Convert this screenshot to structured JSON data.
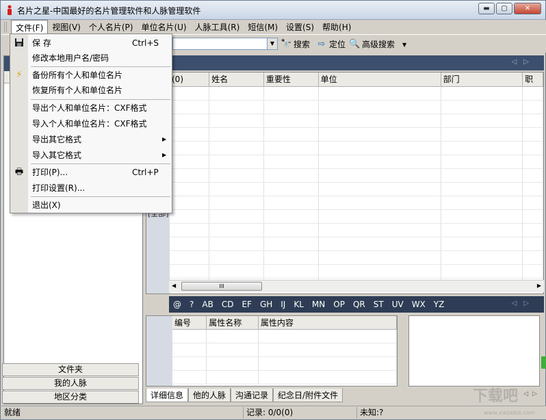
{
  "window": {
    "title": "名片之星-中国最好的名片管理软件和人脉管理软件",
    "minimize": "▬",
    "maximize": "▢",
    "close": "✕"
  },
  "menubar": {
    "items": [
      "文件(F)",
      "视图(V)",
      "个人名片(P)",
      "单位名片(U)",
      "人脉工具(R)",
      "短信(M)",
      "设置(S)",
      "帮助(H)"
    ]
  },
  "toolbar": {
    "search": "搜索",
    "locate": "定位",
    "advanced_search": "高级搜索"
  },
  "file_menu": {
    "save": "保  存",
    "save_shortcut": "Ctrl+S",
    "change_password": "修改本地用户名/密码",
    "backup": "备份所有个人和单位名片",
    "restore": "恢复所有个人和单位名片",
    "export_cxf": "导出个人和单位名片：CXF格式",
    "import_cxf": "导入个人和单位名片：CXF格式",
    "export_other": "导出其它格式",
    "import_other": "导入其它格式",
    "print": "打印(P)...",
    "print_shortcut": "Ctrl+P",
    "print_setup": "打印设置(R)...",
    "exit": "退出(X)"
  },
  "left_panel": {
    "tabs": [
      "文件夹",
      "我的人脉",
      "地区分类"
    ]
  },
  "grid": {
    "columns": [
      "(0)",
      "姓名",
      "重要性",
      "单位",
      "部门",
      "职"
    ],
    "row_marker": "[全部]"
  },
  "alphabet": [
    "@",
    "?",
    "AB",
    "CD",
    "EF",
    "GH",
    "IJ",
    "KL",
    "MN",
    "OP",
    "QR",
    "ST",
    "UV",
    "WX",
    "YZ"
  ],
  "detail": {
    "columns": [
      "编号",
      "属性名称",
      "属性内容"
    ],
    "tabs": [
      "详细信息",
      "他的人脉",
      "沟通记录",
      "纪念日/附件文件"
    ]
  },
  "statusbar": {
    "ready": "就绪",
    "records": "记录: 0/0(0)",
    "unknown": "未知:?"
  },
  "watermark": {
    "text": "下载吧",
    "url": "www.xiazaiba.com"
  },
  "colors": {
    "dark_header": "#3c4f6e",
    "alpha_bar": "#2e3d55",
    "chrome": "#d4d0c8"
  }
}
